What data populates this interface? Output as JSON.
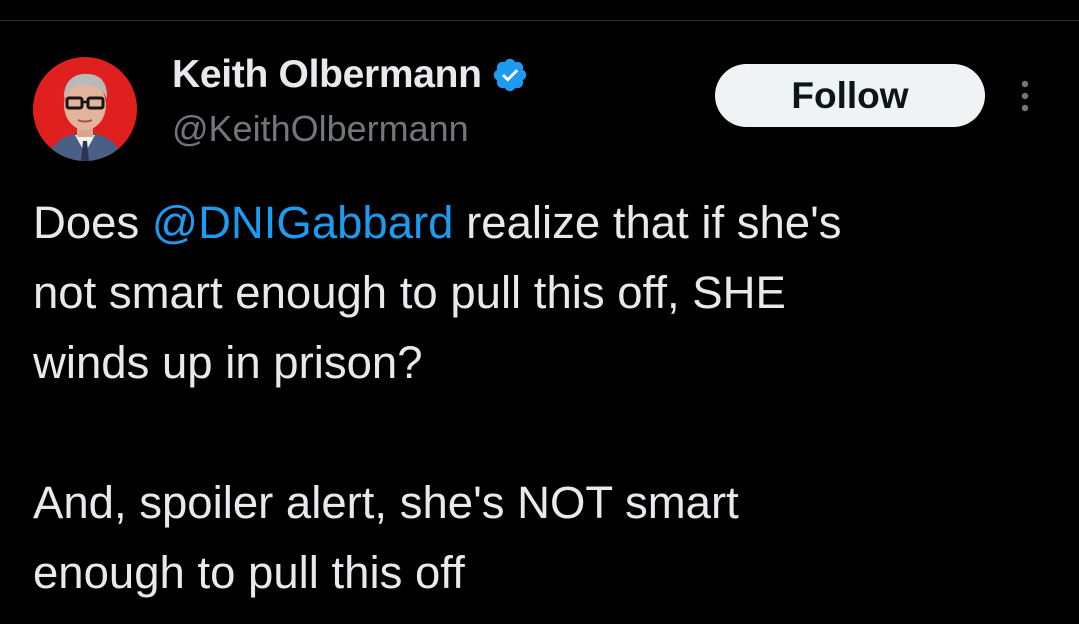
{
  "author": {
    "display_name": "Keith Olbermann",
    "handle": "@KeithOlbermann",
    "verified": true,
    "verified_icon": "verified-badge-icon",
    "avatar_icon": "profile-photo"
  },
  "actions": {
    "follow_label": "Follow",
    "more_icon": "vertical-ellipsis-icon"
  },
  "tweet": {
    "text_before_mention": "Does ",
    "mention": "@DNIGabbard",
    "text_after_mention": " realize that if she's\nnot smart enough to pull this off, SHE\nwinds up in prison?\n\nAnd, spoiler alert, she's NOT smart\nenough to pull this off"
  },
  "colors": {
    "background": "#000000",
    "primary_text": "#e7e9ea",
    "secondary_text": "#71767b",
    "mention": "#1d9bf0",
    "verified": "#1d9bf0",
    "follow_button_bg": "#eff3f4",
    "follow_button_text": "#0f1419",
    "avatar_ring": "#e0201f"
  }
}
